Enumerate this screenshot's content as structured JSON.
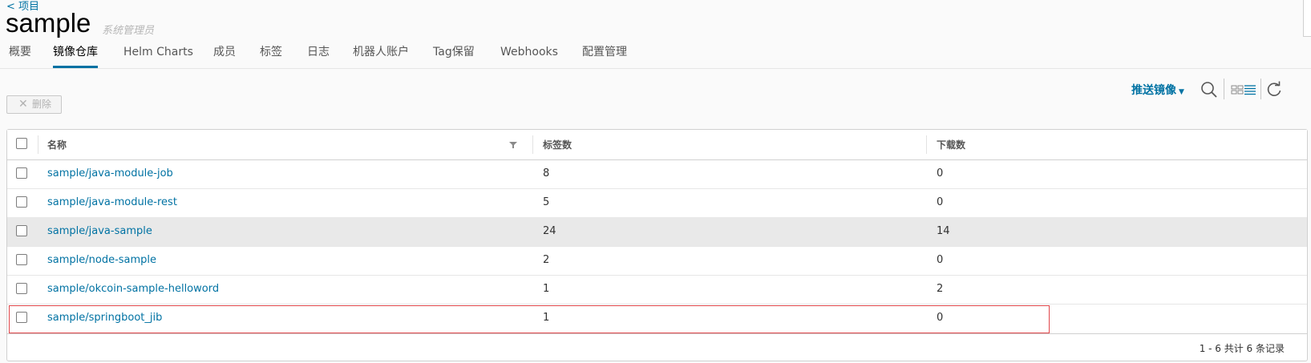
{
  "nav": {
    "back_label": "< 项目"
  },
  "project": {
    "name": "sample",
    "role": "系统管理员"
  },
  "tabs": [
    {
      "label": "概要"
    },
    {
      "label": "镜像仓库",
      "active": true
    },
    {
      "label": "Helm Charts"
    },
    {
      "label": "成员"
    },
    {
      "label": "标签"
    },
    {
      "label": "日志"
    },
    {
      "label": "机器人账户"
    },
    {
      "label": "Tag保留"
    },
    {
      "label": "Webhooks"
    },
    {
      "label": "配置管理"
    }
  ],
  "toolbar": {
    "delete_label": "删除",
    "push_label": "推送镜像",
    "icons": [
      "search-icon",
      "grid-view-icon",
      "list-view-icon",
      "refresh-icon"
    ]
  },
  "table": {
    "columns": [
      "名称",
      "标签数",
      "下载数"
    ],
    "rows": [
      {
        "name": "sample/java-module-job",
        "tags": "8",
        "pulls": "0"
      },
      {
        "name": "sample/java-module-rest",
        "tags": "5",
        "pulls": "0"
      },
      {
        "name": "sample/java-sample",
        "tags": "24",
        "pulls": "14"
      },
      {
        "name": "sample/node-sample",
        "tags": "2",
        "pulls": "0"
      },
      {
        "name": "sample/okcoin-sample-helloword",
        "tags": "1",
        "pulls": "2"
      },
      {
        "name": "sample/springboot_jib",
        "tags": "1",
        "pulls": "0"
      }
    ],
    "footer": "1 - 6 共计 6 条记录"
  },
  "colors": {
    "accent": "#0072a3",
    "highlight_border": "#e0464a"
  }
}
